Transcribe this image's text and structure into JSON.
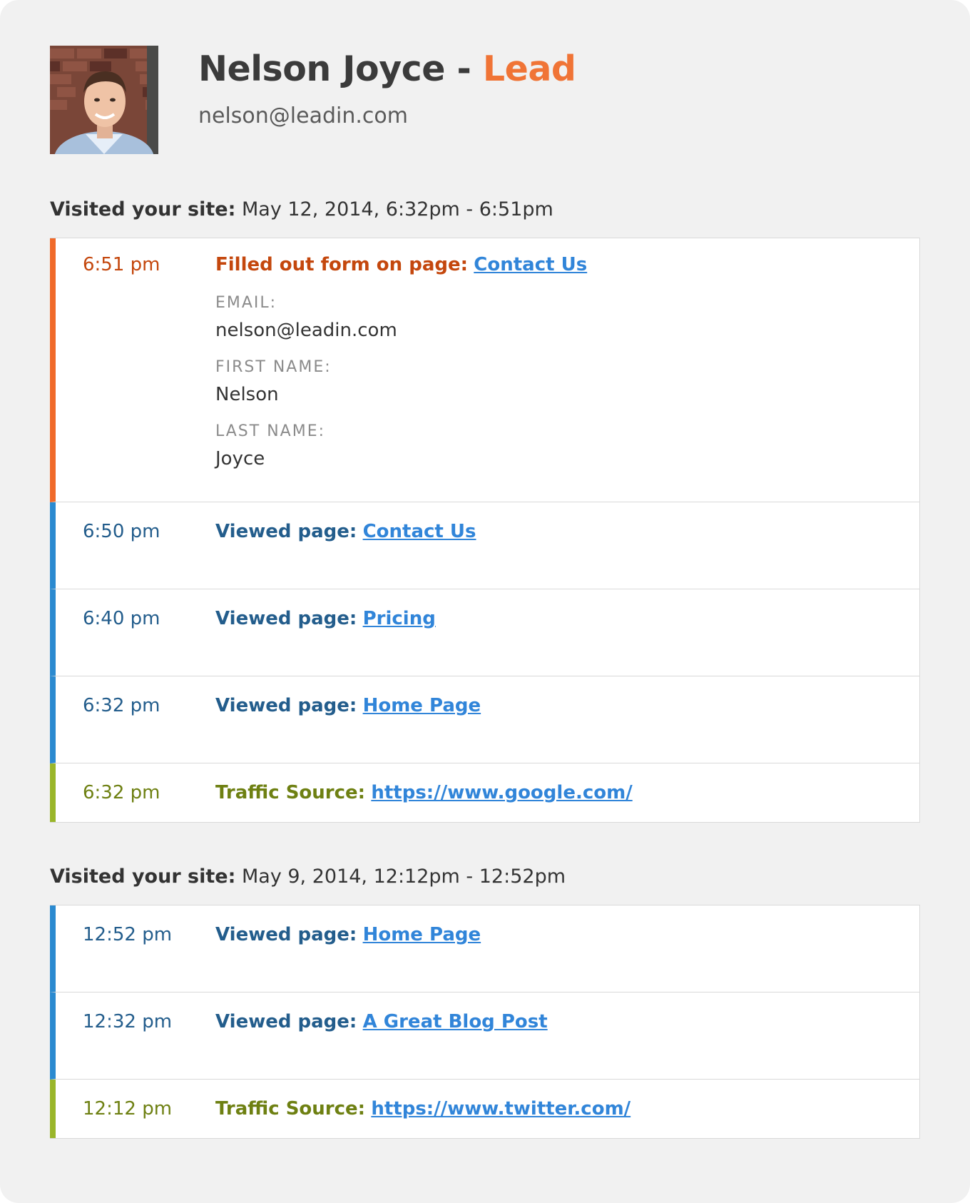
{
  "contact": {
    "name": "Nelson Joyce",
    "separator": " - ",
    "stage": "Lead",
    "email": "nelson@leadin.com",
    "stage_color": "#f07436"
  },
  "sessions": [
    {
      "title_prefix": "Visited your site:",
      "title_range": " May 12, 2014, 6:32pm - 6:51pm",
      "events": [
        {
          "type": "form",
          "time": "6:51 pm",
          "label": "Filled out form on page:",
          "link": "Contact Us",
          "fields": [
            {
              "label": "EMAIL:",
              "value": "nelson@leadin.com"
            },
            {
              "label": "FIRST NAME:",
              "value": "Nelson"
            },
            {
              "label": "LAST NAME:",
              "value": "Joyce"
            }
          ]
        },
        {
          "type": "pageview",
          "time": "6:50 pm",
          "label": "Viewed page:",
          "link": "Contact Us"
        },
        {
          "type": "pageview",
          "time": "6:40 pm",
          "label": "Viewed page:",
          "link": "Pricing"
        },
        {
          "type": "pageview",
          "time": "6:32 pm",
          "label": "Viewed page:",
          "link": "Home Page"
        },
        {
          "type": "source",
          "time": "6:32 pm",
          "label": "Traffic Source:",
          "link": "https://www.google.com/"
        }
      ]
    },
    {
      "title_prefix": "Visited your site:",
      "title_range": " May 9, 2014, 12:12pm - 12:52pm",
      "events": [
        {
          "type": "pageview",
          "time": "12:52 pm",
          "label": "Viewed page:",
          "link": "Home Page"
        },
        {
          "type": "pageview",
          "time": "12:32 pm",
          "label": "Viewed page:",
          "link": "A Great Blog Post"
        },
        {
          "type": "source",
          "time": "12:12 pm",
          "label": "Traffic Source:",
          "link": "https://www.twitter.com/"
        }
      ]
    }
  ],
  "colors": {
    "form_accent": "#f06a2a",
    "pageview_accent": "#2b8ad0",
    "source_accent": "#9ab62a",
    "link": "#3185d9"
  }
}
